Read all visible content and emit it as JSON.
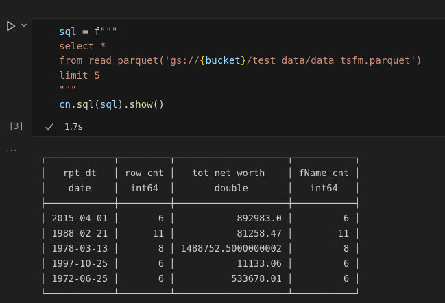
{
  "cell": {
    "execution_count": "[3]",
    "exec_time": "1.7s",
    "output_ellipsis": "...",
    "code": {
      "l1_var": "sql",
      "l1_eq": " = ",
      "l1_prefix": "f",
      "l1_quotes": "\"\"\"",
      "l2": "select *",
      "l3_a": "from read_parquet('gs://",
      "l3_open": "{",
      "l3_var": "bucket",
      "l3_close": "}",
      "l3_b": "/test_data/data_tsfm.parquet')",
      "l4": "limit 5",
      "l5": "\"\"\"",
      "l6_obj": "cn",
      "l6_dot": ".",
      "l6_fn": "sql",
      "l6_p1": "(",
      "l6_arg": "sql",
      "l6_p2": ").",
      "l6_fn2": "show",
      "l6_p3": "()"
    }
  },
  "result_table": {
    "columns": [
      {
        "name": "rpt_dt",
        "type": "date"
      },
      {
        "name": "row_cnt",
        "type": "int64"
      },
      {
        "name": "tot_net_worth",
        "type": "double"
      },
      {
        "name": "fName_cnt",
        "type": "int64"
      }
    ],
    "rows": [
      [
        "2015-04-01",
        "6",
        "892983.0",
        "6"
      ],
      [
        "1988-02-21",
        "11",
        "81258.47",
        "11"
      ],
      [
        "1978-03-13",
        "8",
        "1488752.5000000002",
        "8"
      ],
      [
        "1997-10-25",
        "6",
        "11133.06",
        "6"
      ],
      [
        "1972-06-25",
        "6",
        "533678.01",
        "6"
      ]
    ]
  },
  "colors": {
    "background": "#1f1f1f",
    "cell_background": "#181818",
    "success": "#89d185"
  },
  "icons": {
    "run": "play-icon",
    "chevron": "chevron-down-icon",
    "status": "check-icon"
  }
}
